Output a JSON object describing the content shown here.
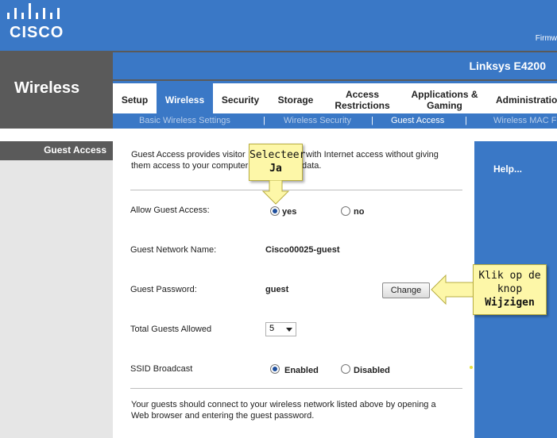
{
  "brand": {
    "logo_text": "CISCO",
    "firmware_label": "Firmw"
  },
  "section_title": "Wireless",
  "product_name": "Linksys E4200",
  "tabs": [
    {
      "label": "Setup"
    },
    {
      "label": "Wireless"
    },
    {
      "label": "Security"
    },
    {
      "label": "Storage"
    },
    {
      "label": "Access Restrictions"
    },
    {
      "label": "Applications & Gaming"
    },
    {
      "label": "Administration"
    }
  ],
  "subnav": [
    {
      "label": "Basic Wireless Settings"
    },
    {
      "label": "Wireless Security"
    },
    {
      "label": "Guest Access"
    },
    {
      "label": "Wireless MAC F"
    }
  ],
  "subnav_separator": "|",
  "left_label": "Guest Access",
  "help_label": "Help...",
  "intro_line1": "Guest Access provides visitor",
  "intro_line1b": "with Internet access without giving",
  "intro_line2": "them access to your computer",
  "intro_line2b": "data.",
  "form": {
    "allow_label": "Allow Guest Access:",
    "allow_yes": "yes",
    "allow_no": "no",
    "network_name_label": "Guest Network Name:",
    "network_name_value": "Cisco00025-guest",
    "password_label": "Guest Password:",
    "password_value": "guest",
    "change_button": "Change",
    "total_guests_label": "Total Guests Allowed",
    "total_guests_value": "5",
    "ssid_label": "SSID Broadcast",
    "ssid_enabled": "Enabled",
    "ssid_disabled": "Disabled"
  },
  "footer_line1": "Your guests should connect to your wireless network listed above by opening a",
  "footer_line2": "Web browser and entering the guest password.",
  "callout_select": {
    "line1": "Selecteer",
    "line2": "Ja"
  },
  "callout_change": {
    "line1": "Klik op de",
    "line2": "knop",
    "line3": "Wijzigen"
  },
  "colors": {
    "accent": "#3a78c6",
    "dark_gray": "#5a5a5a",
    "callout": "#fdf7a8"
  }
}
